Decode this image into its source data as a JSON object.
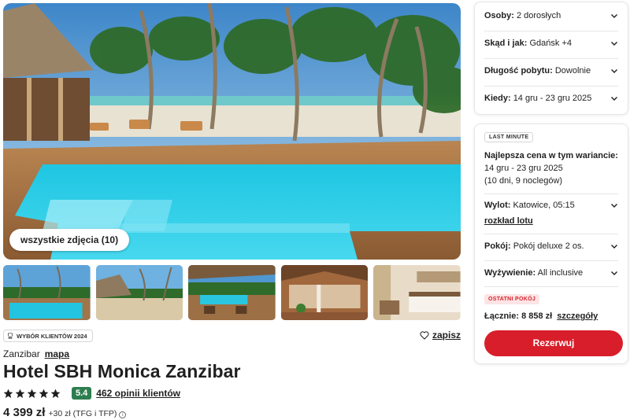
{
  "gallery": {
    "all_photos_label": "wszystkie zdjęcia (10)"
  },
  "award": {
    "label": "WYBÓR KLIENTÓW 2024",
    "icon": "trophy-icon"
  },
  "save": {
    "label": "zapisz",
    "icon": "heart-icon"
  },
  "location": {
    "region": "Zanzibar",
    "map_link": "mapa"
  },
  "hotel": {
    "name": "Hotel SBH Monica Zanzibar",
    "stars": 5,
    "score": "5.4",
    "reviews_link": "462 opinii klientów"
  },
  "price": {
    "main": "4 399 zł",
    "extra": "+30 zł (TFG i TFP)",
    "info_icon": "info-icon"
  },
  "search": {
    "persons": {
      "label": "Osoby:",
      "value": "2 dorosłych"
    },
    "from": {
      "label": "Skąd i jak:",
      "value": "Gdańsk +4"
    },
    "duration": {
      "label": "Długość pobytu:",
      "value": "Dowolnie"
    },
    "when": {
      "label": "Kiedy:",
      "value": "14 gru - 23 gru 2025"
    }
  },
  "offer": {
    "badge": "LAST MINUTE",
    "best_price_title": "Najlepsza cena w tym wariancie:",
    "dates": "14 gru - 23 gru 2025",
    "nights": "(10 dni, 9 noclegów)",
    "flight": {
      "label": "Wylot:",
      "value": "Katowice, 05:15"
    },
    "flight_link": "rozkład lotu",
    "room": {
      "label": "Pokój:",
      "value": "Pokój deluxe 2 os."
    },
    "board": {
      "label": "Wyżywienie:",
      "value": "All inclusive"
    },
    "last_room_badge": "OSTATNI POKÓJ",
    "total_label": "Łącznie:",
    "total_value": "8 858 zł",
    "details_link": "szczegóły",
    "reserve_button": "Rezerwuj"
  },
  "colors": {
    "accent_red": "#d81e2a",
    "score_green": "#2e7d4f",
    "pool_blue": "#19c3dc"
  }
}
